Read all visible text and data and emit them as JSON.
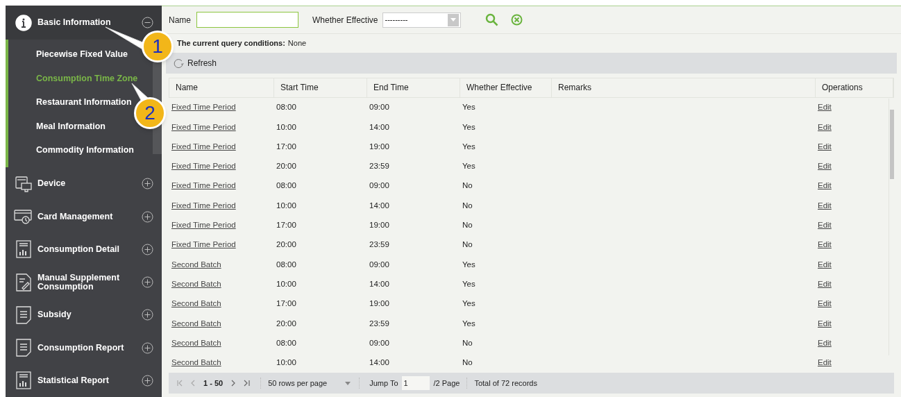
{
  "sidebar": {
    "groups": [
      {
        "label": "Basic Information",
        "expanded": true,
        "items": [
          {
            "label": "Piecewise Fixed Value",
            "selected": false
          },
          {
            "label": "Consumption Time Zone",
            "selected": true
          },
          {
            "label": "Restaurant Information",
            "selected": false
          },
          {
            "label": "Meal Information",
            "selected": false
          },
          {
            "label": "Commodity Information",
            "selected": false
          }
        ]
      },
      {
        "label": "Device",
        "expanded": false
      },
      {
        "label": "Card Management",
        "expanded": false
      },
      {
        "label": "Consumption Detail",
        "expanded": false
      },
      {
        "label": "Manual Supplement Consumption",
        "expanded": false
      },
      {
        "label": "Subsidy",
        "expanded": false
      },
      {
        "label": "Consumption Report",
        "expanded": false
      },
      {
        "label": "Statistical Report",
        "expanded": false
      }
    ]
  },
  "filter": {
    "name_label": "Name",
    "effective_label": "Whether Effective",
    "effective_value": "---------"
  },
  "query_conditions": {
    "label": "The current query conditions:",
    "value": "None"
  },
  "toolbar": {
    "refresh": "Refresh"
  },
  "table": {
    "columns": [
      "Name",
      "Start Time",
      "End Time",
      "Whether Effective",
      "Remarks",
      "Operations"
    ],
    "rows": [
      [
        "Fixed Time Period",
        "08:00",
        "09:00",
        "Yes",
        "",
        "Edit"
      ],
      [
        "Fixed Time Period",
        "10:00",
        "14:00",
        "Yes",
        "",
        "Edit"
      ],
      [
        "Fixed Time Period",
        "17:00",
        "19:00",
        "Yes",
        "",
        "Edit"
      ],
      [
        "Fixed Time Period",
        "20:00",
        "23:59",
        "Yes",
        "",
        "Edit"
      ],
      [
        "Fixed Time Period",
        "08:00",
        "09:00",
        "No",
        "",
        "Edit"
      ],
      [
        "Fixed Time Period",
        "10:00",
        "14:00",
        "No",
        "",
        "Edit"
      ],
      [
        "Fixed Time Period",
        "17:00",
        "19:00",
        "No",
        "",
        "Edit"
      ],
      [
        "Fixed Time Period",
        "20:00",
        "23:59",
        "No",
        "",
        "Edit"
      ],
      [
        "Second Batch",
        "08:00",
        "09:00",
        "Yes",
        "",
        "Edit"
      ],
      [
        "Second Batch",
        "10:00",
        "14:00",
        "Yes",
        "",
        "Edit"
      ],
      [
        "Second Batch",
        "17:00",
        "19:00",
        "Yes",
        "",
        "Edit"
      ],
      [
        "Second Batch",
        "20:00",
        "23:59",
        "Yes",
        "",
        "Edit"
      ],
      [
        "Second Batch",
        "08:00",
        "09:00",
        "No",
        "",
        "Edit"
      ],
      [
        "Second Batch",
        "10:00",
        "14:00",
        "No",
        "",
        "Edit"
      ]
    ]
  },
  "pagination": {
    "range": "1 - 50",
    "rows_per_page": "50 rows per page",
    "jump_label": "Jump To",
    "page": "1",
    "pages": "/2 Page",
    "total": "Total of 72 records"
  },
  "callouts": [
    "1",
    "2"
  ]
}
